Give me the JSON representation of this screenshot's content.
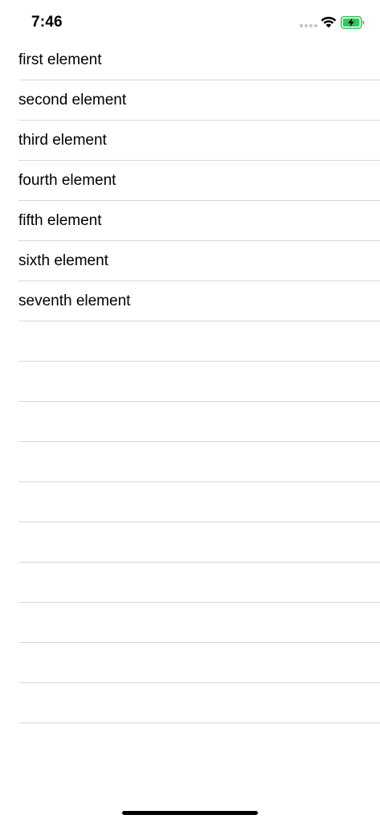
{
  "status_bar": {
    "time": "7:46",
    "signal_icon": "cellular-signal-icon",
    "wifi_icon": "wifi-icon",
    "battery_icon": "battery-charging-icon",
    "battery_color": "#34c759"
  },
  "list": {
    "items": [
      {
        "label": "first element"
      },
      {
        "label": "second element"
      },
      {
        "label": "third element"
      },
      {
        "label": "fourth element"
      },
      {
        "label": "fifth element"
      },
      {
        "label": "sixth element"
      },
      {
        "label": "seventh element"
      },
      {
        "label": ""
      },
      {
        "label": ""
      },
      {
        "label": ""
      },
      {
        "label": ""
      },
      {
        "label": ""
      },
      {
        "label": ""
      },
      {
        "label": ""
      },
      {
        "label": ""
      },
      {
        "label": ""
      },
      {
        "label": ""
      },
      {
        "label": ""
      }
    ]
  }
}
